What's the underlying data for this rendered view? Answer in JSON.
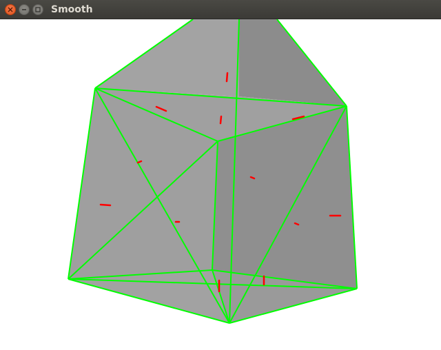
{
  "window": {
    "title": "Smooth",
    "controls": {
      "close_icon": "close-icon",
      "minimize_icon": "minimize-icon",
      "maximize_icon": "maximize-icon"
    }
  },
  "viewport": {
    "background": "#ffffff",
    "face_colors": [
      "#a3a3a3",
      "#9c9c9c",
      "#959595",
      "#8e8e8e",
      "#878787"
    ],
    "wireframe_color": "#00ff00",
    "normal_color": "#ff0000"
  }
}
